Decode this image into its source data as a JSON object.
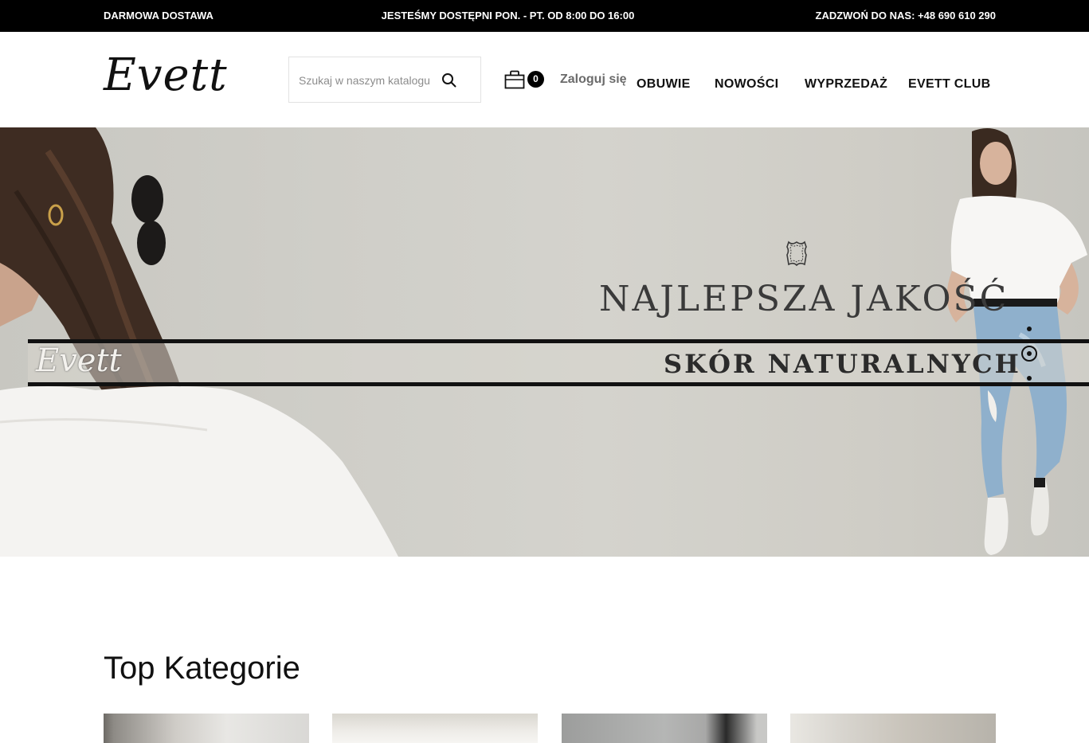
{
  "topbar": {
    "left": "DARMOWA DOSTAWA",
    "center": "JESTEŚMY DOSTĘPNI PON. - PT. OD 8:00 DO 16:00",
    "right": "ZADZWOŃ DO NAS: +48 690 610 290"
  },
  "header": {
    "logo": "Evett",
    "search": {
      "placeholder": "Szukaj w naszym katalogu",
      "value": ""
    },
    "cart_count": "0",
    "login": "Zaloguj się",
    "nav": [
      "OBUWIE",
      "NOWOŚCI",
      "WYPRZEDAŻ",
      "EVETT CLUB"
    ]
  },
  "hero": {
    "logo": "Evett",
    "headline": "NAJLEPSZA JAKOŚĆ",
    "subheadline": "SKÓR NATURALNYCH",
    "slides_total": 3,
    "active_slide": 2
  },
  "section": {
    "title": "Top Kategorie"
  },
  "colors": {
    "topbar_bg": "#000000",
    "accent": "#111111",
    "login_text": "#6b6b6b",
    "hero_bg": "#cfcec8"
  }
}
